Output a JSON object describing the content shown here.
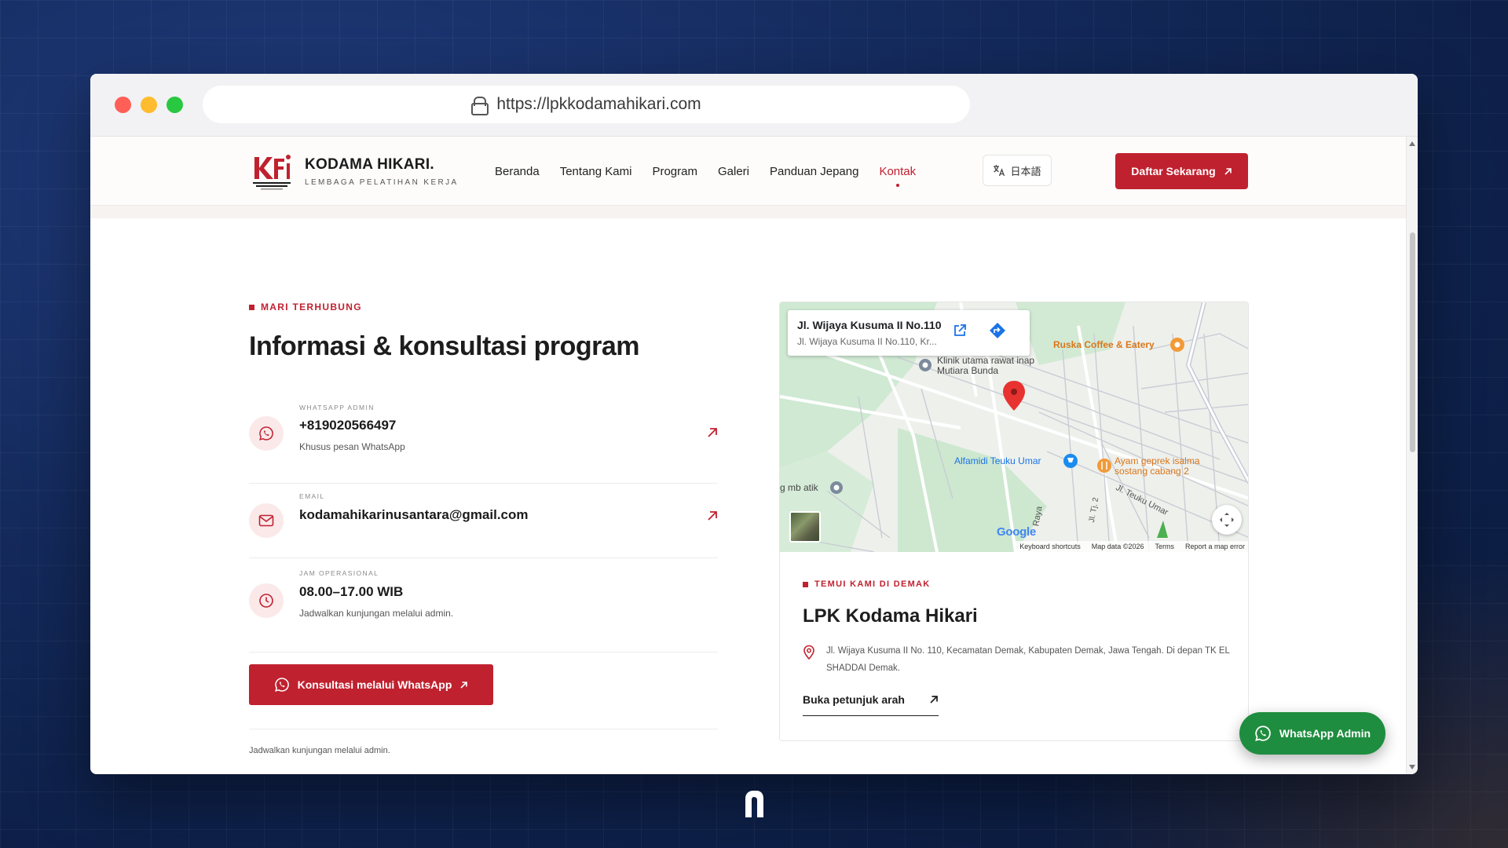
{
  "browser": {
    "url": "https://lpkkodamahikari.com"
  },
  "header": {
    "brand_name": "KODAMA HIKARI.",
    "brand_tagline": "LEMBAGA PELATIHAN KERJA",
    "nav": [
      {
        "label": "Beranda"
      },
      {
        "label": "Tentang Kami"
      },
      {
        "label": "Program"
      },
      {
        "label": "Galeri"
      },
      {
        "label": "Panduan Jepang"
      },
      {
        "label": "Kontak",
        "active": true
      }
    ],
    "lang_label": "日本語",
    "cta_label": "Daftar Sekarang"
  },
  "contact": {
    "eyebrow": "MARI TERHUBUNG",
    "heading": "Informasi & konsultasi program",
    "items": [
      {
        "label": "WHATSAPP ADMIN",
        "value": "+819020566497",
        "sub": "Khusus pesan WhatsApp"
      },
      {
        "label": "EMAIL",
        "value": "kodamahikarinusantara@gmail.com"
      },
      {
        "label": "JAM OPERASIONAL",
        "value": "08.00–17.00 WIB",
        "sub": "Jadwalkan kunjungan melalui admin."
      }
    ],
    "wa_button": "Konsultasi melalui WhatsApp",
    "foot_note": "Jadwalkan kunjungan melalui admin."
  },
  "map": {
    "popup_title": "Jl. Wijaya Kusuma II No.110",
    "popup_sub": "Jl. Wijaya Kusuma II No.110, Kr...",
    "places": [
      "Ruska Coffee & Eatery",
      "Klinik utama rawat inap Mutiara Bunda",
      "Alfamidi Teuku Umar",
      "Ayam geprek isalma sostang cabang 2",
      "g mb atik"
    ],
    "streets": [
      "Jl. Teuku Umar",
      "Raya",
      "Jl. Tj. 2"
    ],
    "google": "Google",
    "footer": [
      "Keyboard shortcuts",
      "Map data ©2026",
      "Terms",
      "Report a map error"
    ]
  },
  "location": {
    "eyebrow": "TEMUI KAMI DI DEMAK",
    "title": "LPK Kodama Hikari",
    "address": "Jl. Wijaya Kusuma II No. 110, Kecamatan Demak, Kabupaten Demak, Jawa Tengah. Di depan TK EL SHADDAI Demak.",
    "directions_label": "Buka petunjuk arah"
  },
  "float_wa": "WhatsApp Admin",
  "colors": {
    "brand_red": "#c0212f",
    "whatsapp_green": "#1f8d3f",
    "bg_navy": "#142a5c"
  }
}
